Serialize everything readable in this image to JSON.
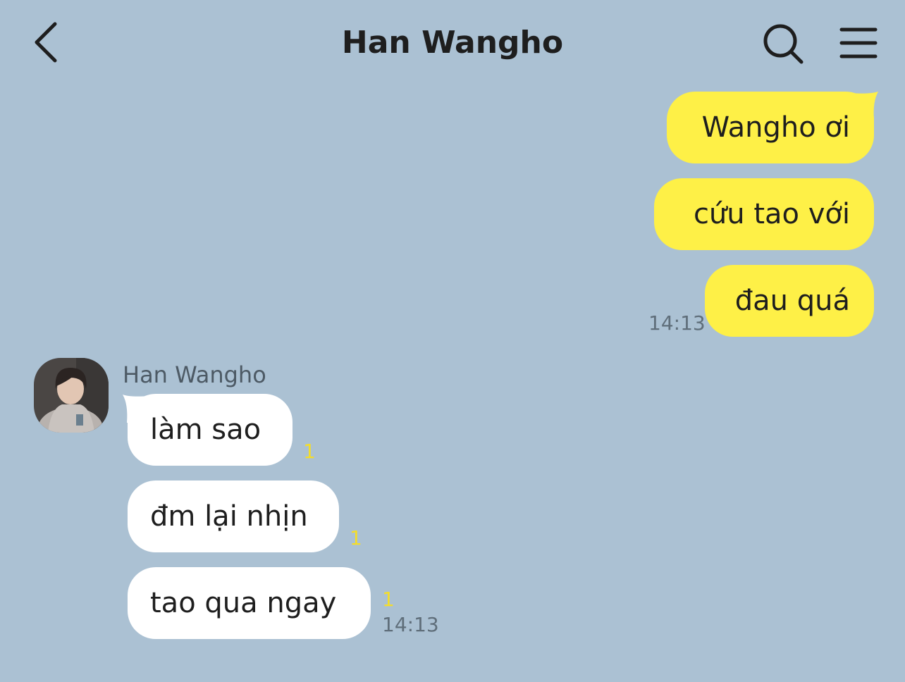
{
  "header": {
    "title": "Han Wangho"
  },
  "icons": {
    "back": "chevron-left",
    "search": "magnifier",
    "menu": "hamburger"
  },
  "colors": {
    "background": "#abc1d3",
    "my_bubble": "#fef047",
    "their_bubble": "#ffffff",
    "unread": "#f4dd2a"
  },
  "messages_out": [
    {
      "text": "Wangho ơi"
    },
    {
      "text": "cứu tao với"
    },
    {
      "text": "đau quá",
      "time": "14:13"
    }
  ],
  "messages_in": {
    "sender": "Han Wangho",
    "items": [
      {
        "text": "làm sao",
        "unread": "1"
      },
      {
        "text": "đm lại nhịn",
        "unread": "1"
      },
      {
        "text": "tao qua ngay",
        "unread": "1",
        "time": "14:13"
      }
    ]
  }
}
